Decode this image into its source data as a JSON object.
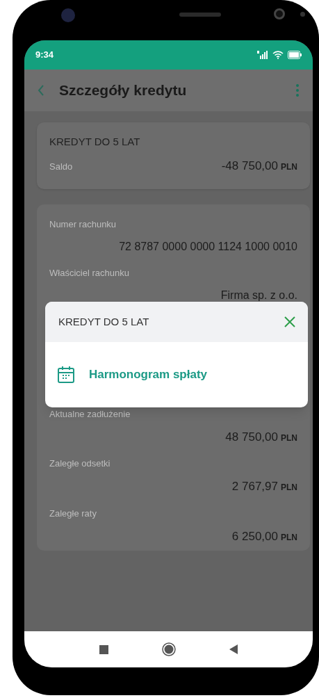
{
  "status_bar": {
    "time": "9:34"
  },
  "header": {
    "title": "Szczegóły kredytu"
  },
  "summary_card": {
    "title": "KREDYT DO 5 LAT",
    "label": "Saldo",
    "amount": "-48 750,00",
    "currency": "PLN"
  },
  "details_top": [
    {
      "kind": "text",
      "label": "Numer rachunku",
      "value": "72 8787 0000 0000 1124 1000 0010"
    },
    {
      "kind": "text",
      "label": "Właściciel rachunku",
      "value": "Firma sp. z o.o."
    }
  ],
  "details_bottom": [
    {
      "kind": "amount",
      "label": "Aktualne zadłużenie",
      "value": "48 750,00",
      "currency": "PLN"
    },
    {
      "kind": "amount",
      "label": "Zaległe odsetki",
      "value": "2 767,97",
      "currency": "PLN"
    },
    {
      "kind": "amount",
      "label": "Zaległe raty",
      "value": "6 250,00",
      "currency": "PLN"
    }
  ],
  "modal": {
    "title": "KREDYT DO 5 LAT",
    "items": [
      {
        "label": "Harmonogram spłaty"
      }
    ]
  }
}
